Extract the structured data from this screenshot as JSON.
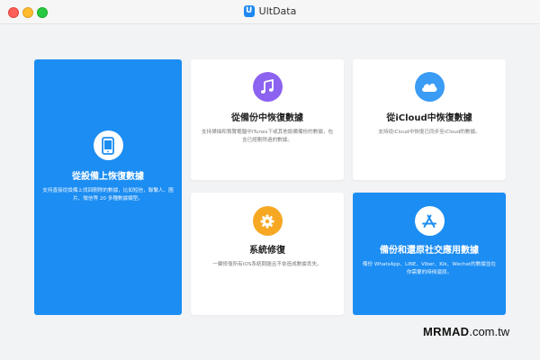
{
  "window": {
    "title": "UltData",
    "logo_letter": "U"
  },
  "cards": {
    "device": {
      "title": "從設備上恢復數據",
      "desc": "支持直接從設備上找回刪除的數據，比如短信，聯繫人、圖片、微信等 20 多種數據類型。",
      "icon": "phone-icon"
    },
    "itunes": {
      "title": "從備份中恢復數據",
      "desc": "支持掃描和預覽電腦中iTunes下或其他設備備份的數據，包含已經刪除過的數據。",
      "icon": "music-note-icon"
    },
    "icloud": {
      "title": "從iCloud中恢復數據",
      "desc": "支持從iCloud中恢復已同步至iCloud的數據。",
      "icon": "cloud-icon"
    },
    "repair": {
      "title": "系統修復",
      "desc": "一鍵修復所有iOS系統問題且不會造成數據丟失。",
      "icon": "gear-icon"
    },
    "social": {
      "title": "備份和還原社交應用數據",
      "desc": "備份 WhatsApp、LINE、Viber、Kik、Wechat的數據並在你需要的時候還原。",
      "icon": "app-store-icon"
    }
  },
  "watermark": {
    "brand": "MRMAD",
    "domain": ".com.tw"
  },
  "colors": {
    "accent_blue": "#1c8df2",
    "itunes_purple": "#8c62f0",
    "icloud_blue": "#3a9cf4",
    "repair_orange": "#f6a823"
  }
}
